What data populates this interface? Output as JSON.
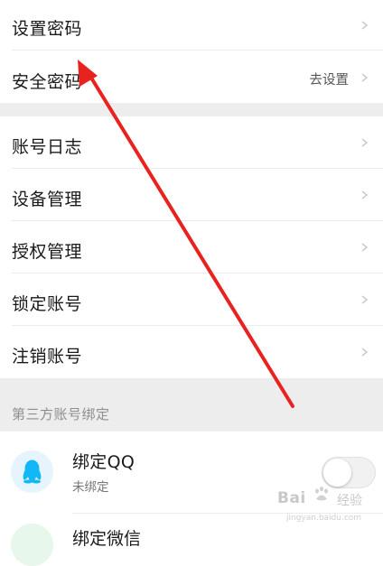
{
  "rows": [
    {
      "label": "设置密码",
      "value": ""
    },
    {
      "label": "安全密码",
      "value": "去设置"
    },
    {
      "label": "账号日志",
      "value": ""
    },
    {
      "label": "设备管理",
      "value": ""
    },
    {
      "label": "授权管理",
      "value": ""
    },
    {
      "label": "锁定账号",
      "value": ""
    },
    {
      "label": "注销账号",
      "value": ""
    }
  ],
  "third_party": {
    "header": "第三方账号绑定",
    "qq": {
      "title": "绑定QQ",
      "status": "未绑定",
      "enabled": false
    },
    "wechat": {
      "title": "绑定微信"
    }
  },
  "watermark": {
    "brand": "Bai",
    "brand_suffix": "经验",
    "url": "jingyan.baidu.com"
  },
  "colors": {
    "annotation_arrow": "#e8231f",
    "section_bg": "#ededed",
    "qq_blue": "#12b7f5"
  }
}
